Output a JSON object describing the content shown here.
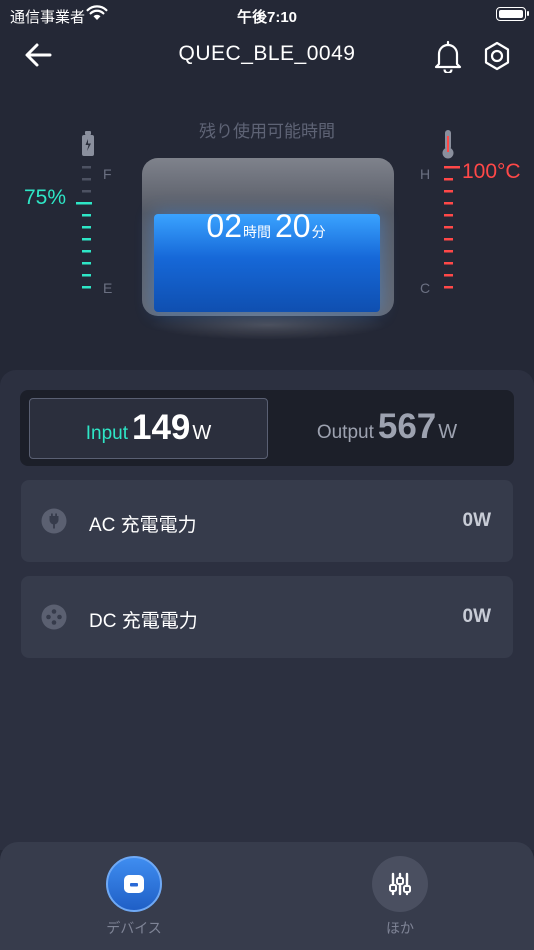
{
  "status_bar": {
    "carrier": "通信事業者",
    "time": "午後7:10"
  },
  "header": {
    "title": "QUEC_BLE_0049"
  },
  "hero": {
    "remaining_label": "残り使用可能時間",
    "battery_percent": "75%",
    "battery_level": 0.75,
    "battery_top_letter": "F",
    "battery_bottom_letter": "E",
    "temp_value": "100°C",
    "temp_top_letter": "H",
    "temp_bottom_letter": "C",
    "hours": "02",
    "hours_unit": "時間",
    "minutes": "20",
    "minutes_unit": "分"
  },
  "io": {
    "input_label": "Input",
    "input_value": "149",
    "input_unit": "W",
    "output_label": "Output",
    "output_value": "567",
    "output_unit": "W",
    "selected": "input"
  },
  "cards": [
    {
      "label": "AC 充電電力",
      "value": "0W",
      "icon": "ac-plug-icon"
    },
    {
      "label": "DC 充電電力",
      "value": "0W",
      "icon": "dc-plug-icon"
    }
  ],
  "nav": {
    "devices_label": "デバイス",
    "more_label": "ほか",
    "active": "devices"
  },
  "colors": {
    "accent_teal": "#2ee6c6",
    "temp_red": "#ff4848",
    "background": "#242836",
    "active_nav": "#2f77e0"
  }
}
